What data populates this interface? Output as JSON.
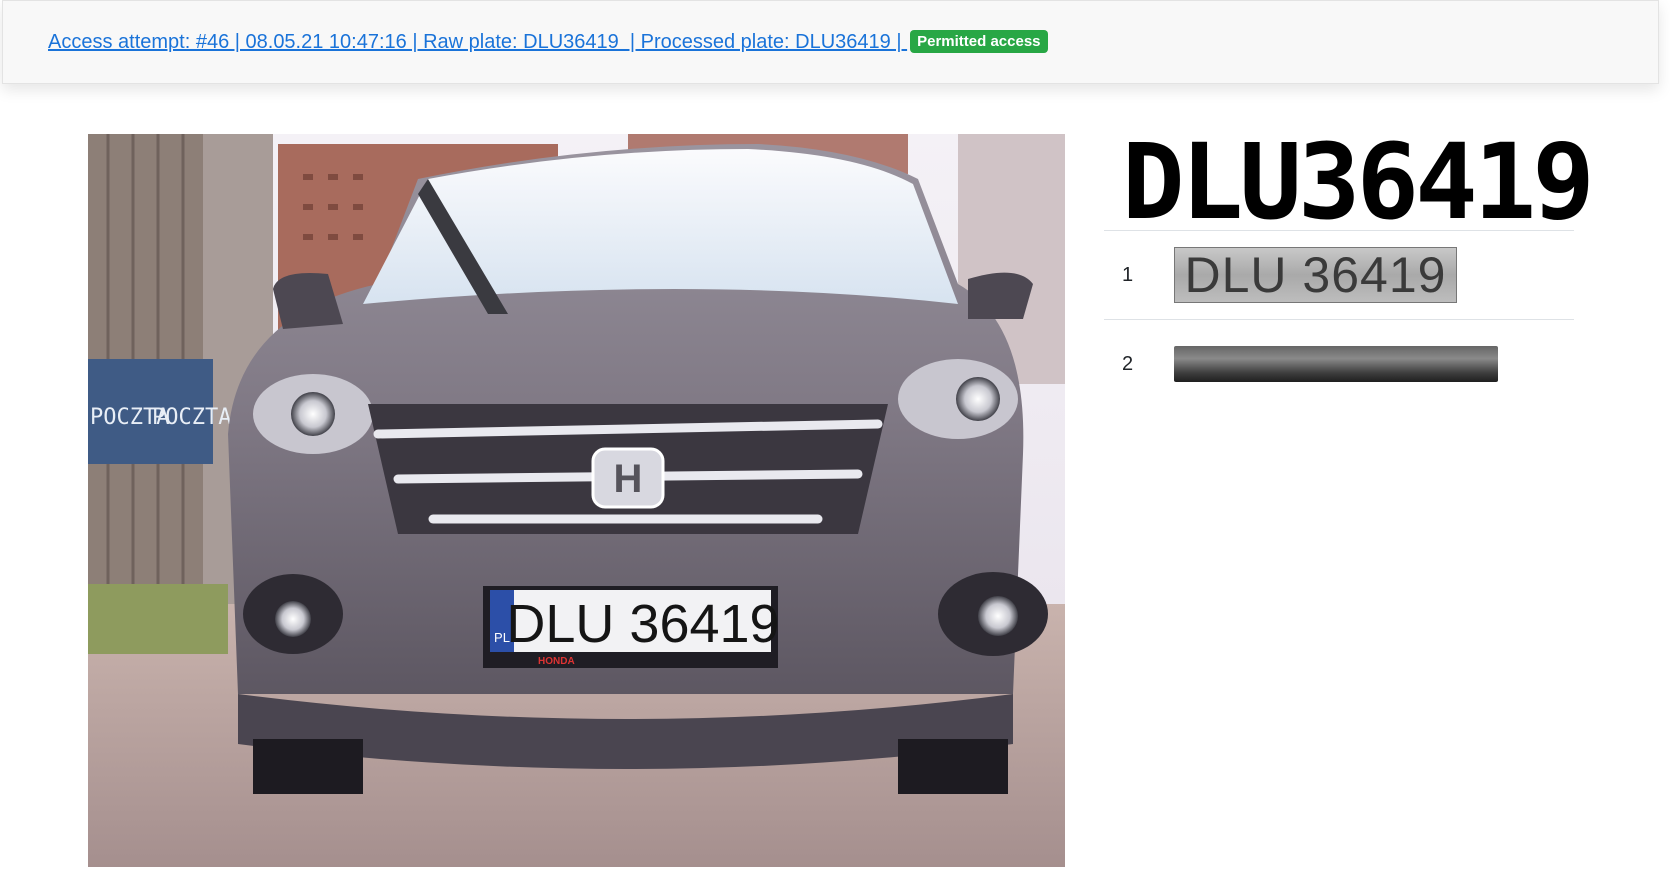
{
  "header": {
    "link_text": "Access attempt: #46 | 08.05.21 10:47:16 | Raw plate: DLU36419  | Processed plate: DLU36419 | ",
    "badge_label": "Permitted access",
    "badge_color": "#28a745",
    "link_color": "#1a73d9"
  },
  "photo": {
    "mailbox_text_1": "POCZTA",
    "mailbox_text_2": "POCZTA",
    "plate_text": "DLU 36419",
    "plate_country": "PL",
    "dealer_text": "HONDA"
  },
  "plate_panel": {
    "processed_plate": "DLU36419",
    "candidates": [
      {
        "index": "1",
        "crop_text": "DLU 36419"
      },
      {
        "index": "2",
        "crop_text": ""
      }
    ]
  }
}
